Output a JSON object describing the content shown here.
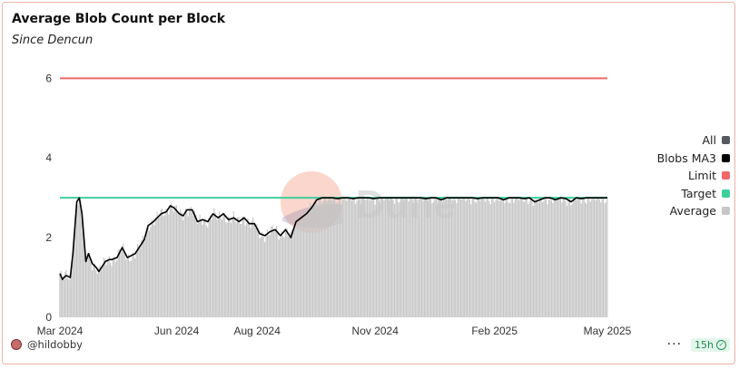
{
  "title": "Average Blob Count per Block",
  "subtitle": "Since Dencun",
  "legend": [
    {
      "label": "All",
      "color": "#555a60"
    },
    {
      "label": "Blobs MA3",
      "color": "#000000"
    },
    {
      "label": "Limit",
      "color": "#f06868"
    },
    {
      "label": "Target",
      "color": "#3fcf9c"
    },
    {
      "label": "Average",
      "color": "#c6c6c6"
    }
  ],
  "footer": {
    "author": "@hildobby",
    "refresh": "15h",
    "more_label": "···"
  },
  "watermark": "Dune",
  "chart_data": {
    "type": "bar",
    "x_ticks": [
      "Mar 2024",
      "Jun 2024",
      "Aug 2024",
      "Nov 2024",
      "Feb 2025",
      "May 2025"
    ],
    "y_ticks": [
      "0",
      "2",
      "4",
      "6"
    ],
    "ylim": [
      0,
      6.6
    ],
    "reference_lines": [
      {
        "name": "Limit",
        "value": 6,
        "color": "#f06868"
      },
      {
        "name": "Target",
        "value": 3,
        "color": "#3fcf9c"
      }
    ],
    "series_ma3": {
      "name": "Blobs MA3",
      "x": [
        0,
        2,
        3,
        5,
        8,
        10,
        13,
        15,
        17,
        20,
        22,
        25,
        28,
        30,
        33,
        35,
        38,
        40,
        44,
        48,
        52,
        55,
        58,
        62,
        65,
        68,
        72,
        75,
        78,
        82,
        85,
        88,
        92,
        95,
        98,
        102,
        106,
        110,
        114,
        118,
        122,
        126,
        130,
        134,
        138,
        142,
        146,
        150,
        154,
        158,
        162,
        166,
        170,
        174,
        178,
        182,
        186,
        190,
        194,
        198,
        202,
        206,
        210,
        214,
        218,
        222,
        226,
        230,
        234,
        238,
        242,
        246,
        250,
        254,
        258,
        262,
        266,
        270,
        274,
        278,
        282,
        286,
        290,
        294,
        298,
        302,
        306,
        310,
        314,
        318,
        322,
        326,
        330,
        334,
        338,
        342,
        346,
        350,
        354,
        358,
        362,
        366,
        370,
        374,
        378,
        382,
        386,
        390,
        394,
        398,
        402,
        406,
        410,
        414,
        418,
        422
      ],
      "values": [
        1.1,
        0.95,
        1.0,
        1.05,
        1.0,
        1.6,
        2.9,
        3.0,
        2.6,
        1.4,
        1.6,
        1.35,
        1.25,
        1.15,
        1.3,
        1.4,
        1.45,
        1.45,
        1.5,
        1.75,
        1.5,
        1.55,
        1.6,
        1.8,
        1.95,
        2.3,
        2.4,
        2.5,
        2.6,
        2.65,
        2.8,
        2.75,
        2.6,
        2.55,
        2.7,
        2.7,
        2.4,
        2.45,
        2.4,
        2.6,
        2.5,
        2.6,
        2.45,
        2.5,
        2.4,
        2.5,
        2.35,
        2.35,
        2.1,
        2.05,
        2.15,
        2.2,
        2.05,
        2.2,
        2.0,
        2.4,
        2.5,
        2.6,
        2.75,
        2.95,
        3.0,
        3.0,
        3.0,
        2.98,
        3.0,
        3.0,
        2.98,
        3.0,
        3.0,
        3.0,
        2.98,
        3.0,
        3.0,
        3.0,
        3.0,
        3.0,
        3.0,
        3.0,
        3.0,
        3.0,
        2.98,
        3.0,
        3.0,
        2.95,
        3.0,
        3.0,
        3.0,
        3.0,
        3.0,
        3.0,
        2.98,
        3.0,
        3.0,
        3.0,
        3.0,
        2.95,
        3.0,
        3.0,
        3.0,
        2.98,
        3.0,
        2.9,
        2.95,
        3.0,
        3.0,
        2.95,
        3.0,
        2.98,
        2.9,
        3.0,
        2.98,
        3.0,
        3.0,
        3.0,
        3.0,
        3.0
      ]
    },
    "series_average": {
      "name": "Average",
      "x_days": [
        0,
        422
      ],
      "approximate_daily_values_follow_ma3": true
    },
    "x_range_days": [
      0,
      422
    ]
  }
}
